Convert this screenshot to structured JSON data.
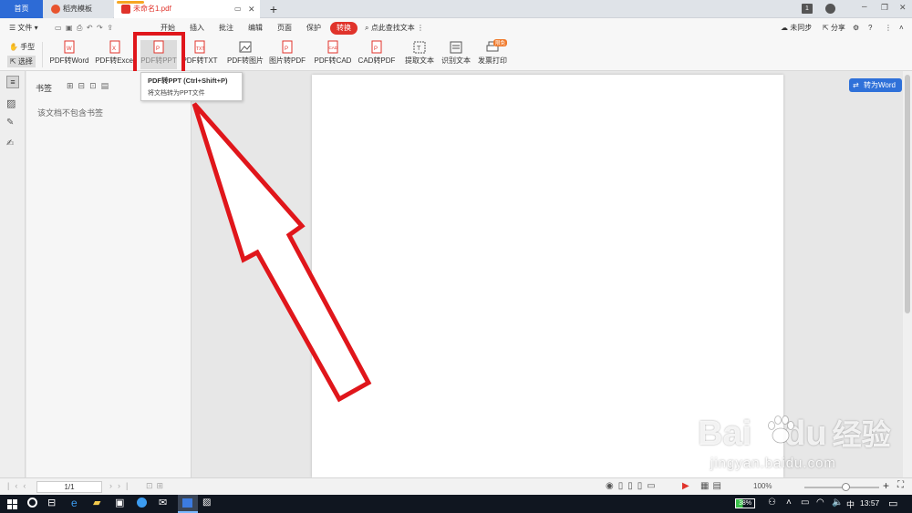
{
  "tabs": {
    "home": "首页",
    "template": "稻壳模板",
    "file": "未命名1.pdf",
    "new_tab": "+"
  },
  "menu": {
    "file": "文件",
    "items": [
      "开始",
      "插入",
      "批注",
      "编辑",
      "页面",
      "保护",
      "转换"
    ],
    "search": "点此查找文本",
    "sync": "未同步",
    "share": "分享"
  },
  "tools": {
    "hand": "手型",
    "select": "选择"
  },
  "ribbon": {
    "items": [
      "PDF转Word",
      "PDF转Excel",
      "PDF转PPT",
      "PDF转TXT",
      "PDF转图片",
      "图片转PDF",
      "PDF转CAD",
      "CAD转PDF",
      "提取文本",
      "识别文本",
      "发票打印"
    ],
    "badge": "限免"
  },
  "tooltip": {
    "title": "PDF转PPT (Ctrl+Shift+P)",
    "desc": "将文档转为PPT文件"
  },
  "bookmark": {
    "title": "书签",
    "empty": "该文档不包含书签"
  },
  "convert_word": "转为Word",
  "status": {
    "page": "1/1",
    "zoom": "100%"
  },
  "taskbar": {
    "battery": "38%",
    "lang": "中",
    "time": "13:57"
  },
  "watermark": {
    "brand": "Bai",
    "brand2": "du",
    "cn": "经验",
    "url": "jingyan.baidu.com"
  },
  "colors": {
    "accent": "#e0332b",
    "blue": "#2d6bd6",
    "highlight_box": "#e0161b"
  }
}
